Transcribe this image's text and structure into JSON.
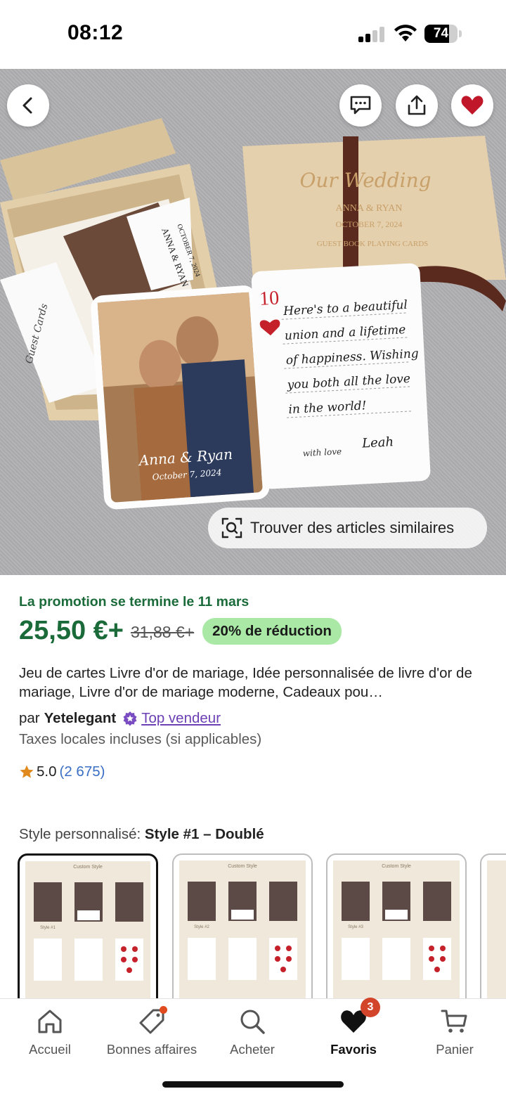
{
  "status_bar": {
    "time": "08:12",
    "battery": "74",
    "battery_level": 0.74
  },
  "hero": {
    "card_names": "Anna & Ryan",
    "card_date": "October 7, 2024",
    "box_title": "Our Wedding",
    "box_names": "ANNA & RYAN",
    "box_date": "OCTOBER 7, 2024",
    "box_subtitle": "GUEST BOOK PLAYING CARDS",
    "guest_cards_label": "Guest Cards",
    "back_card_names": "ANNA & RYAN",
    "back_card_date": "OCTOBER 7, 2024",
    "playing_card_rank": "10",
    "handwritten_lines": [
      "Here's to a beautiful",
      "union and a lifetime",
      "of happiness. Wishing",
      "you both all the love",
      "in the world!"
    ],
    "handwritten_signoff": "with love",
    "handwritten_signature": "Leah",
    "similar_button": "Trouver des articles similaires"
  },
  "product": {
    "promo": "La promotion se termine le 11 mars",
    "price": "25,50 €+",
    "old_price": "31,88 €+",
    "discount": "20% de réduction",
    "title": "Jeu de cartes Livre d'or de mariage, Idée personnalisée de livre d'or de mariage, Livre d'or de mariage moderne, Cadeaux pou…",
    "seller_prefix": "par",
    "seller": "Yetelegant",
    "top_seller": "Top vendeur",
    "tax": "Taxes locales incluses (si applicables)",
    "rating": "5.0",
    "reviews": "(2 675)"
  },
  "style": {
    "label": "Style personnalisé:",
    "value": "Style #1 – Doublé",
    "thumb_header": "Custom Style",
    "thumbs": [
      "Style #1",
      "Style #2",
      "Style #3"
    ]
  },
  "nav": {
    "items": [
      {
        "label": "Accueil"
      },
      {
        "label": "Bonnes affaires"
      },
      {
        "label": "Acheter"
      },
      {
        "label": "Favoris",
        "badge": "3"
      },
      {
        "label": "Panier"
      }
    ]
  },
  "colors": {
    "green": "#1b6b3a",
    "discount_bg": "#a9e8a5",
    "heart": "#c0182a",
    "badge": "#d2452b",
    "link": "#3a6fc4",
    "purple": "#6c3fb5"
  }
}
